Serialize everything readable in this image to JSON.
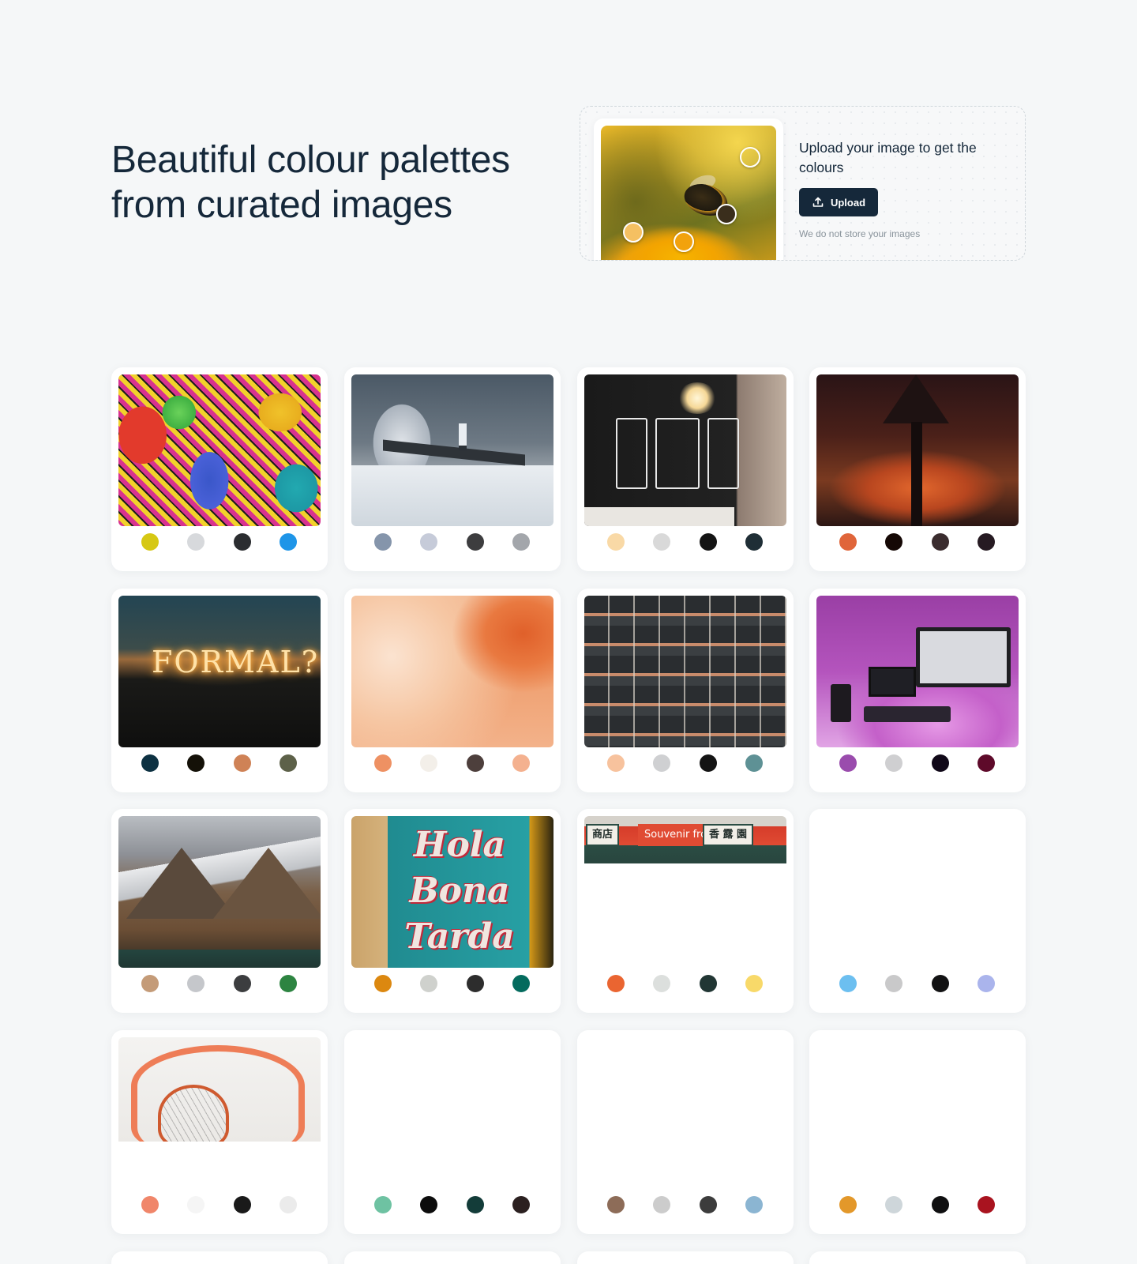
{
  "hero": {
    "title": "Beautiful colour palettes from curated images"
  },
  "upload": {
    "text": "Upload your image to get the colours",
    "button_label": "Upload",
    "note": "We do not store your images"
  },
  "cards": [
    {
      "image": "colorful-graffiti-wall-photo",
      "swatches": [
        "#d6c814",
        "#d7d9dc",
        "#2b2d30",
        "#1e95e8"
      ]
    },
    {
      "image": "lighthouse-waves-photo",
      "swatches": [
        "#8595ab",
        "#c6cbd9",
        "#3d3d3f",
        "#a3a6ab"
      ]
    },
    {
      "image": "cafe-chalkboard-photo",
      "swatches": [
        "#f9d9a6",
        "#d9d9d9",
        "#141414",
        "#1f2e36"
      ]
    },
    {
      "image": "sunset-lamp-photo",
      "swatches": [
        "#e0653a",
        "#150805",
        "#3a2c2e",
        "#261a22"
      ]
    },
    {
      "image": "sparkler-formal-photo",
      "swatches": [
        "#0d3142",
        "#141108",
        "#cf8256",
        "#5d6149"
      ]
    },
    {
      "image": "autumn-fog-photo",
      "swatches": [
        "#ee9163",
        "#f3efe9",
        "#4d3f3c",
        "#f4b18f"
      ]
    },
    {
      "image": "scaffold-building-photo",
      "swatches": [
        "#f7c29d",
        "#cfd0d2",
        "#141414",
        "#5e9195"
      ]
    },
    {
      "image": "purple-studio-photo",
      "swatches": [
        "#9a4cad",
        "#cfcfd1",
        "#100818",
        "#5e0a2a"
      ]
    },
    {
      "image": "snowy-mountain-photo",
      "swatches": [
        "#c49b78",
        "#c5c7cb",
        "#3c3d3f",
        "#2d8441"
      ]
    },
    {
      "image": "hola-bona-tarda-photo",
      "swatches": [
        "#dc8810",
        "#cfd1cd",
        "#2d2d2d",
        "#046b5e"
      ]
    },
    {
      "image": "street-signs-photo",
      "swatches": [
        "#ea6531",
        "#dcdfdd",
        "#213634",
        "#f8d969"
      ]
    },
    {
      "image": "",
      "swatches": [
        "#6cbff0",
        "#c9c9ca",
        "#121213",
        "#aab4ec"
      ]
    },
    {
      "image": "basketball-hoop-photo",
      "swatches": [
        "#f0866a",
        "#f5f5f5",
        "#1a1a1a",
        "#ebebeb"
      ]
    },
    {
      "image": "",
      "swatches": [
        "#6ec2a2",
        "#0c0c0c",
        "#133c39",
        "#2b2020"
      ]
    },
    {
      "image": "",
      "swatches": [
        "#8d6c58",
        "#cccccc",
        "#3c3c3c",
        "#8bb5d2"
      ]
    },
    {
      "image": "",
      "swatches": [
        "#e3982a",
        "#ced6da",
        "#0f0f10",
        "#a9131f"
      ]
    }
  ],
  "image_texts": {
    "formal": "FORMAL?",
    "hola": "Hola Bona Tarda",
    "street_sign_1": "商店",
    "street_sign_2": "Souvenir from",
    "street_sign_3": "香 露 園"
  }
}
